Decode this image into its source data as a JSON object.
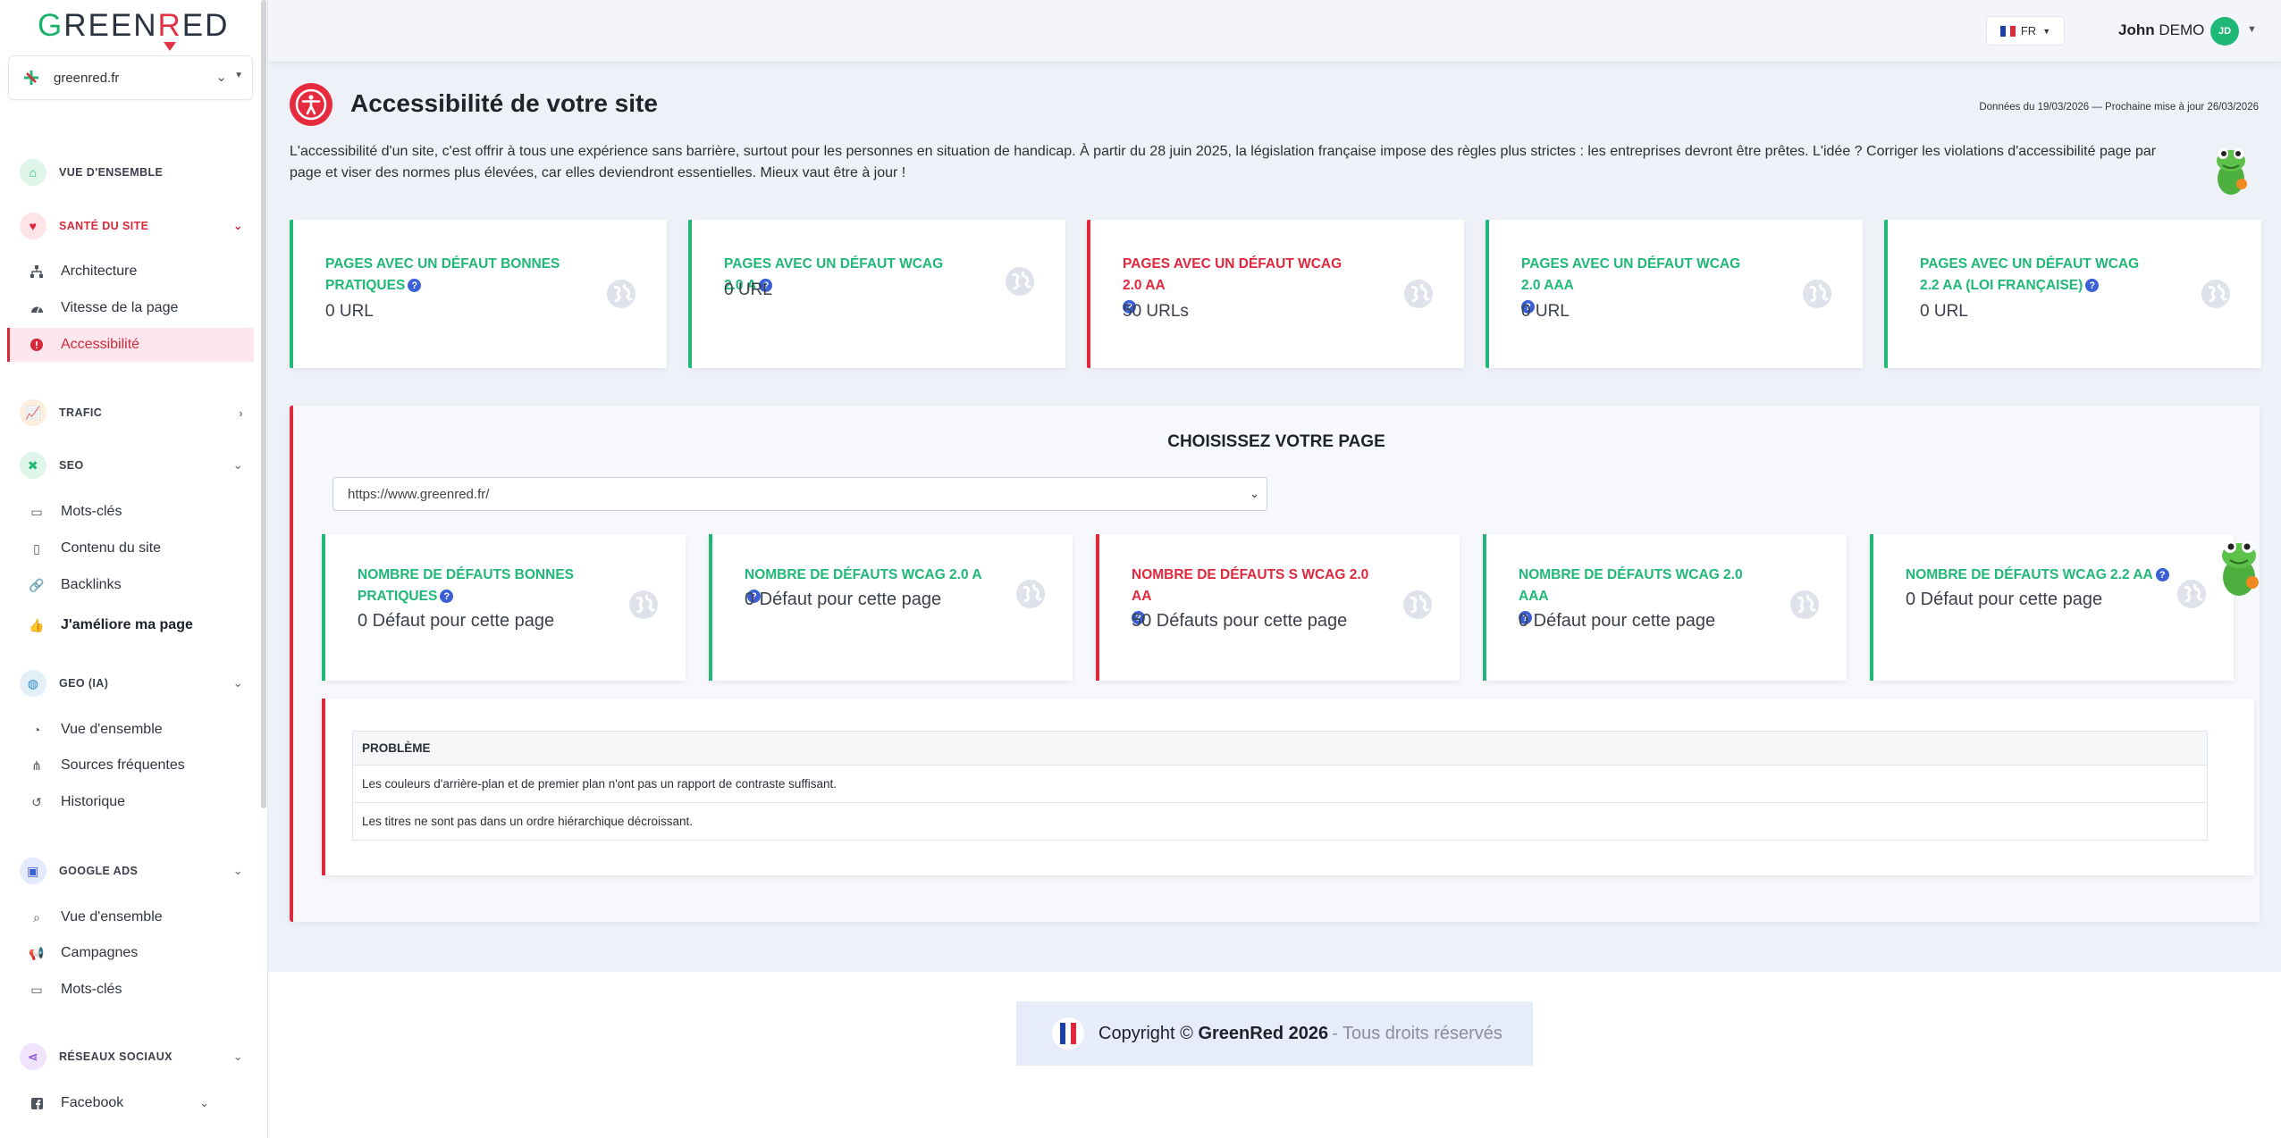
{
  "brand": {
    "logo_g": "G",
    "logo_mid": "REEN",
    "logo_r": "R",
    "logo_end": "ED",
    "accent_green": "#1fb877",
    "accent_red": "#e0283d"
  },
  "site_selector": {
    "value": "greenred.fr"
  },
  "sidebar": {
    "overview": "VUE D'ENSEMBLE",
    "health": {
      "label": "SANTÉ DU SITE",
      "items": [
        "Architecture",
        "Vitesse de la page",
        "Accessibilité"
      ]
    },
    "traffic": "TRAFIC",
    "seo": {
      "label": "SEO",
      "items": [
        "Mots-clés",
        "Contenu du site",
        "Backlinks",
        "J'améliore ma page"
      ]
    },
    "geo": {
      "label": "GEO (IA)",
      "items": [
        "Vue d'ensemble",
        "Sources fréquentes",
        "Historique"
      ]
    },
    "ads": {
      "label": "GOOGLE ADS",
      "items": [
        "Vue d'ensemble",
        "Campagnes",
        "Mots-clés"
      ]
    },
    "social": {
      "label": "RÉSEAUX SOCIAUX",
      "items": [
        "Facebook"
      ]
    }
  },
  "topbar": {
    "lang": "FR",
    "user_first": "John",
    "user_last": "DEMO",
    "avatar_initials": "JD"
  },
  "page": {
    "title": "Accessibilité de votre site",
    "dates": "Données du 19/03/2026 — Prochaine mise à jour 26/03/2026",
    "intro": "L'accessibilité d'un site, c'est offrir à tous une expérience sans barrière, surtout pour les personnes en situation de handicap. À partir du 28 juin 2025, la législation française impose des règles plus strictes : les entreprises devront être prêtes. L'idée ? Corriger les violations d'accessibilité page par page et viser des normes plus élevées, car elles deviendront essentielles. Mieux vaut être à jour !"
  },
  "kpis": [
    {
      "label": "PAGES AVEC UN DÉFAUT BONNES PRATIQUES",
      "value": "0 URL",
      "status": "ok"
    },
    {
      "label": "PAGES AVEC UN DÉFAUT WCAG 2.0 A",
      "value": "0 URL",
      "status": "ok"
    },
    {
      "label": "PAGES AVEC UN DÉFAUT WCAG 2.0 AA",
      "value": "50 URLs",
      "status": "error"
    },
    {
      "label": "PAGES AVEC UN DÉFAUT WCAG 2.0 AAA",
      "value": "0 URL",
      "status": "ok"
    },
    {
      "label": "PAGES AVEC UN DÉFAUT WCAG 2.2 AA (LOI FRANÇAISE)",
      "value": "0 URL",
      "status": "ok"
    }
  ],
  "page_panel": {
    "title": "CHOISISSEZ VOTRE PAGE",
    "selected_page": "https://www.greenred.fr/",
    "kpis": [
      {
        "label": "NOMBRE DE DÉFAUTS BONNES PRATIQUES",
        "value": "0 Défaut pour cette page",
        "status": "ok"
      },
      {
        "label": "NOMBRE DE DÉFAUTS WCAG 2.0 A",
        "value": "0 Défaut pour cette page",
        "status": "ok"
      },
      {
        "label": "NOMBRE DE DÉFAUTS S WCAG 2.0 AA",
        "value": "50 Défauts pour cette page",
        "status": "error"
      },
      {
        "label": "NOMBRE DE DÉFAUTS WCAG 2.0 AAA",
        "value": "0 Défaut pour cette page",
        "status": "ok"
      },
      {
        "label": "NOMBRE DE DÉFAUTS WCAG 2.2 AA",
        "value": "0 Défaut pour cette page",
        "status": "ok"
      }
    ],
    "table_header": "PROBLÈME",
    "issues": [
      "Les couleurs d'arrière-plan et de premier plan n'ont pas un rapport de contraste suffisant.",
      "Les titres ne sont pas dans un ordre hiérarchique décroissant."
    ]
  },
  "footer": {
    "copyright_prefix": "Copyright ©",
    "brand": "GreenRed 2026",
    "suffix": "- Tous droits réservés"
  },
  "help_glyph": "?"
}
